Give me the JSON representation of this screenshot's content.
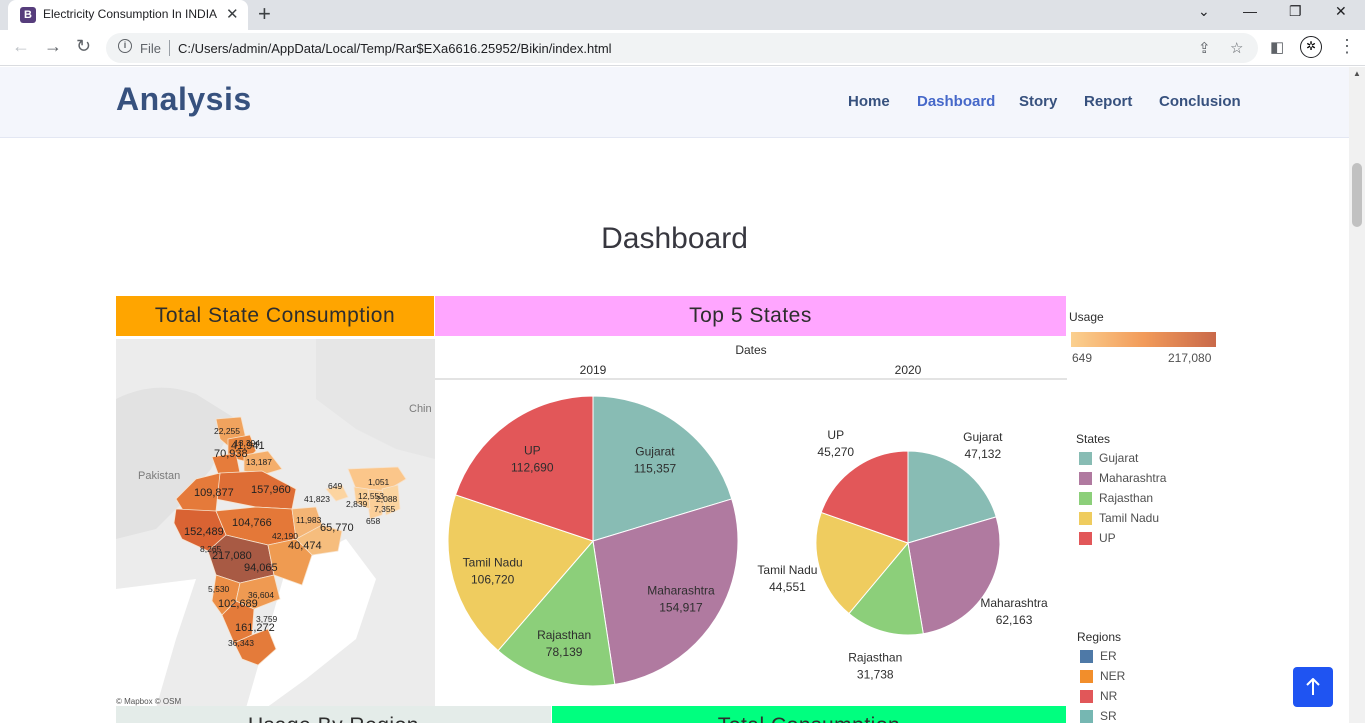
{
  "browser": {
    "tab_title": "Electricity Consumption In INDIA",
    "tab_favicon": "B",
    "omnibox_scheme": "File",
    "url": "C:/Users/admin/AppData/Local/Temp/Rar$EXa6616.25952/Bikin/index.html"
  },
  "header": {
    "brand": "Analysis",
    "nav": [
      "Home",
      "Dashboard",
      "Story",
      "Report",
      "Conclusion"
    ],
    "active": "Dashboard"
  },
  "section_title": "Dashboard",
  "panels": {
    "map_title": "Total State Consumption",
    "pie_title": "Top 5 States",
    "map_attribution": "© Mapbox © OSM",
    "bottom_left_title": "Usage By Region",
    "bottom_right_title": "Total Consumption"
  },
  "colors": {
    "map_header": "#ffa500",
    "pie_header": "#ffa6ff",
    "bottom_left_header": "#e4ece9",
    "bottom_right_header": "#00ff7f",
    "to_top_button": "#1f54f2"
  },
  "usage_colorbar": {
    "title": "Usage",
    "min_label": "649",
    "max_label": "217,080"
  },
  "map_labels": [
    "22,255",
    "13,394",
    "70,938",
    "13,187",
    "41,941",
    "109,877",
    "157,960",
    "649",
    "1,051",
    "41,823",
    "12,553",
    "2,088",
    "2,839",
    "7,355",
    "658",
    "11,983",
    "104,766",
    "65,770",
    "40,474",
    "42,190",
    "152,489",
    "8,265",
    "217,080",
    "94,065",
    "5,530",
    "36,604",
    "102,689",
    "3,759",
    "161,272",
    "36,343"
  ],
  "map_places": [
    "Pakistan",
    "Chin"
  ],
  "chart_data": [
    {
      "type": "pie",
      "title": "2019",
      "group_label": "Dates",
      "categories": [
        "Gujarat",
        "Maharashtra",
        "Rajasthan",
        "Tamil Nadu",
        "UP"
      ],
      "values": [
        115357,
        154917,
        78139,
        106720,
        112690
      ],
      "labels": [
        "115,357",
        "154,917",
        "78,139",
        "106,720",
        "112,690"
      ],
      "colors": [
        "#88bcb4",
        "#b07aa0",
        "#8ccf7a",
        "#efcc5f",
        "#e25759"
      ]
    },
    {
      "type": "pie",
      "title": "2020",
      "categories": [
        "Gujarat",
        "Maharashtra",
        "Rajasthan",
        "Tamil Nadu",
        "UP"
      ],
      "values": [
        47132,
        62163,
        31738,
        44551,
        45270
      ],
      "labels": [
        "47,132",
        "62,163",
        "31,738",
        "44,551",
        "45,270"
      ],
      "colors": [
        "#88bcb4",
        "#b07aa0",
        "#8ccf7a",
        "#efcc5f",
        "#e25759"
      ]
    }
  ],
  "states_legend": {
    "title": "States",
    "items": [
      {
        "label": "Gujarat",
        "color": "#88bcb4"
      },
      {
        "label": "Maharashtra",
        "color": "#b07aa0"
      },
      {
        "label": "Rajasthan",
        "color": "#8ccf7a"
      },
      {
        "label": "Tamil Nadu",
        "color": "#efcc5f"
      },
      {
        "label": "UP",
        "color": "#e25759"
      }
    ]
  },
  "regions_legend": {
    "title": "Regions",
    "items": [
      {
        "label": "ER",
        "color": "#4e79a7"
      },
      {
        "label": "NER",
        "color": "#f28e2b"
      },
      {
        "label": "NR",
        "color": "#e15759"
      },
      {
        "label": "SR",
        "color": "#76b7b2"
      }
    ]
  }
}
